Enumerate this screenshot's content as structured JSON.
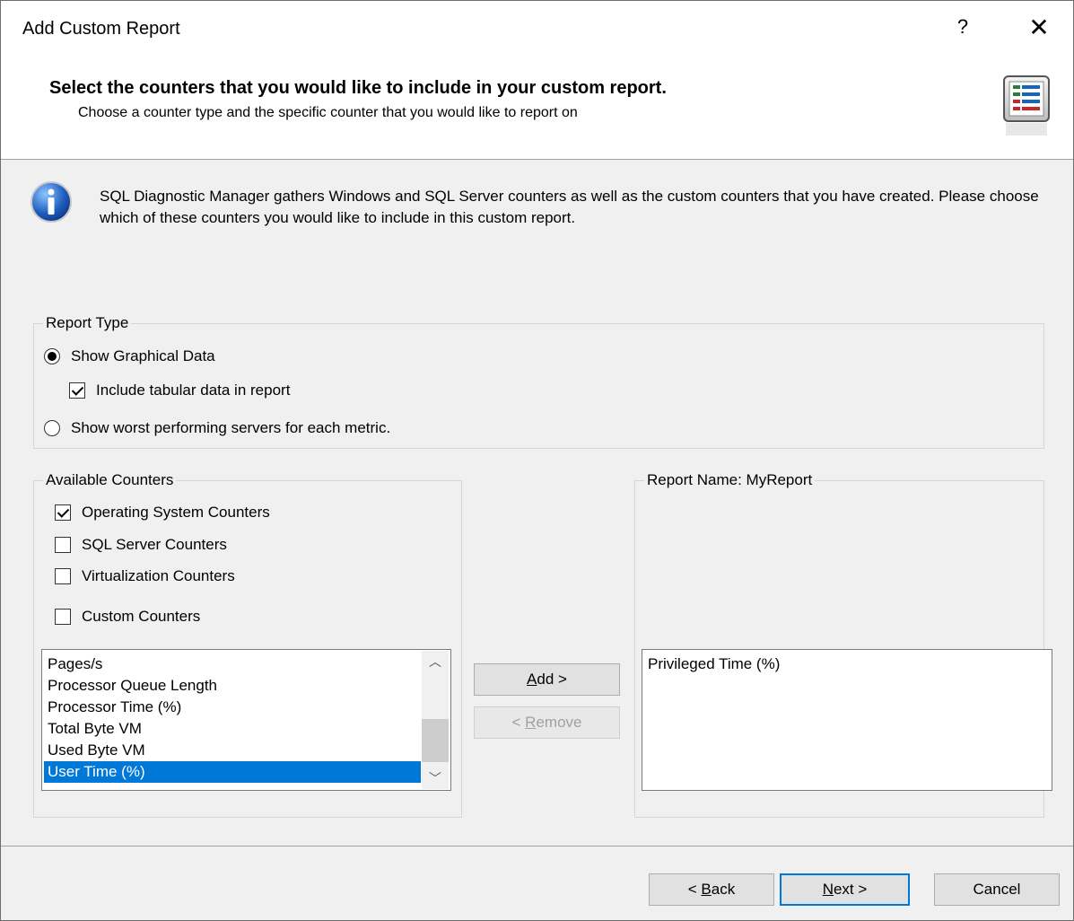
{
  "window": {
    "title": "Add Custom Report",
    "help_label": "?",
    "close_label": "✕"
  },
  "header": {
    "title": "Select the counters that you would like to include in your custom report.",
    "subtitle": "Choose a counter type and the specific counter that you would like to report on",
    "icon": "report-list-icon"
  },
  "info": {
    "icon": "info-icon",
    "text": "SQL Diagnostic Manager gathers Windows and SQL Server counters as well as the custom counters that you have created.  Please choose which of these counters you would like to include in this custom report."
  },
  "report_type": {
    "legend": "Report Type",
    "show_graphical": {
      "label": "Show Graphical Data",
      "selected": true
    },
    "include_tabular": {
      "label": "Include tabular data in report",
      "checked": true
    },
    "show_worst": {
      "label": "Show worst performing servers for each metric.",
      "selected": false
    }
  },
  "available_counters": {
    "legend": "Available Counters",
    "categories": [
      {
        "label": "Operating System Counters",
        "checked": true
      },
      {
        "label": "SQL Server Counters",
        "checked": false
      },
      {
        "label": "Virtualization Counters",
        "checked": false
      },
      {
        "label": "Custom Counters",
        "checked": false
      }
    ],
    "items": [
      "Pages/s",
      "Processor Queue Length",
      "Processor Time (%)",
      "Total Byte VM",
      "Used Byte VM",
      "User Time (%)"
    ],
    "selected_item": "User Time (%)"
  },
  "transfer": {
    "add_label_mnemonic": "A",
    "add_label_rest": "dd >",
    "remove_label_prefix": "< ",
    "remove_label_mnemonic": "R",
    "remove_label_rest": "emove"
  },
  "report_name": {
    "legend": "Report Name: MyReport",
    "items": [
      "Privileged Time (%)"
    ]
  },
  "footer": {
    "back_prefix": "< ",
    "back_mnemonic": "B",
    "back_rest": "ack",
    "next_mnemonic": "N",
    "next_rest": "ext >",
    "cancel_label": "Cancel"
  },
  "colors": {
    "selection": "#0078d7",
    "dialog_bg": "#f0f0f0"
  }
}
